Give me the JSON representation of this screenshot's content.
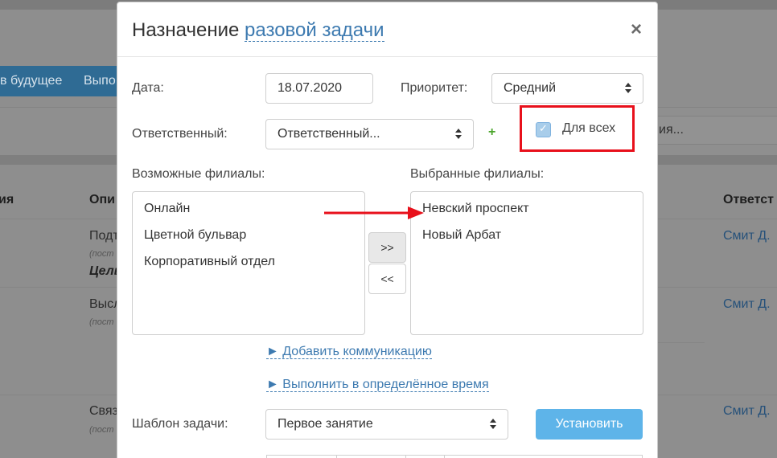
{
  "background": {
    "buttons": [
      "в будущее",
      "Выпо"
    ],
    "search_text": "ия...",
    "columns": [
      "ия",
      "Опи",
      "Ответст"
    ],
    "rows": [
      {
        "description": "Подт",
        "subtitle": "(пост",
        "extra": "Цель",
        "responsible": "Смит Д."
      },
      {
        "description": "Высл",
        "subtitle": "(пост",
        "responsible": "Смит Д."
      },
      {
        "description": "Связ",
        "subtitle": "(пост",
        "responsible": "Смит Д."
      }
    ]
  },
  "modal": {
    "title_plain": "Назначение",
    "title_accent": "разовой задачи",
    "close_label": "×",
    "date": {
      "label": "Дата:",
      "value": "18.07.2020"
    },
    "priority": {
      "label": "Приоритет:",
      "value": "Средний"
    },
    "responsible": {
      "label": "Ответственный:",
      "value": "Ответственный...",
      "add_label": "+"
    },
    "for_all": {
      "label": "Для всех",
      "checked": true
    },
    "available": {
      "label": "Возможные филиалы:",
      "items": [
        "Онлайн",
        "Цветной бульвар",
        "Корпоративный отдел"
      ]
    },
    "selected": {
      "label": "Выбранные филиалы:",
      "items": [
        "Невский проспект",
        "Новый Арбат"
      ]
    },
    "move_forward": ">>",
    "move_back": "<<",
    "links": {
      "add_communication": "► Добавить коммуникацию",
      "run_at_time": "► Выполнить в определённое время"
    },
    "template": {
      "label": "Шаблон задачи:",
      "value": "Первое занятие",
      "apply_label": "Установить"
    }
  },
  "colors": {
    "accent": "#3d7ab0",
    "primary_button": "#5eb4e9",
    "annotation": "#e8101b",
    "add_icon": "#4aa52a"
  }
}
